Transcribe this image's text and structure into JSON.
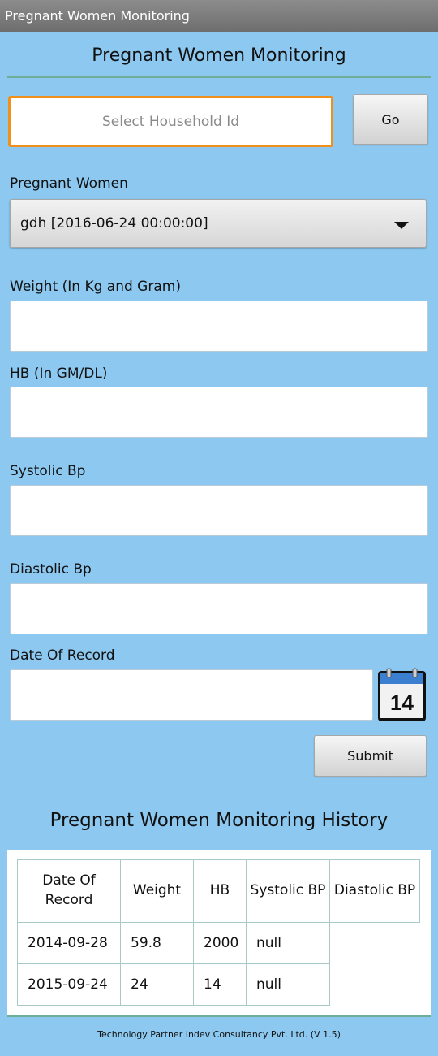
{
  "app": {
    "window_title": "Pregnant Women Monitoring"
  },
  "header": {
    "title": "Pregnant Women Monitoring"
  },
  "household": {
    "placeholder": "Select Household Id",
    "go_label": "Go"
  },
  "pregnant_women": {
    "label": "Pregnant Women",
    "selected": "gdh [2016-06-24 00:00:00]"
  },
  "form": {
    "weight_label": "Weight (In Kg and Gram)",
    "hb_label": "HB (In GM/DL)",
    "systolic_label": "Systolic Bp",
    "diastolic_label": "Diastolic Bp",
    "date_label": "Date Of Record",
    "calendar_day": "14",
    "submit_label": "Submit"
  },
  "history": {
    "title": "Pregnant Women Monitoring History",
    "columns": [
      "Date Of Record",
      "Weight",
      "HB",
      "Systolic BP",
      "Diastolic BP"
    ],
    "rows": [
      [
        "2014-09-28",
        "59.8",
        "2000",
        "null"
      ],
      [
        "2015-09-24",
        "24",
        "14",
        "null"
      ]
    ]
  },
  "footer": {
    "text": "Technology Partner Indev Consultancy Pvt. Ltd. (V 1.5)"
  },
  "colors": {
    "background": "#8cc8f0",
    "focus_border": "#f0901a",
    "divider": "#6fae96"
  },
  "icons": {
    "calendar": "calendar-icon",
    "dropdown": "chevron-down-icon"
  }
}
